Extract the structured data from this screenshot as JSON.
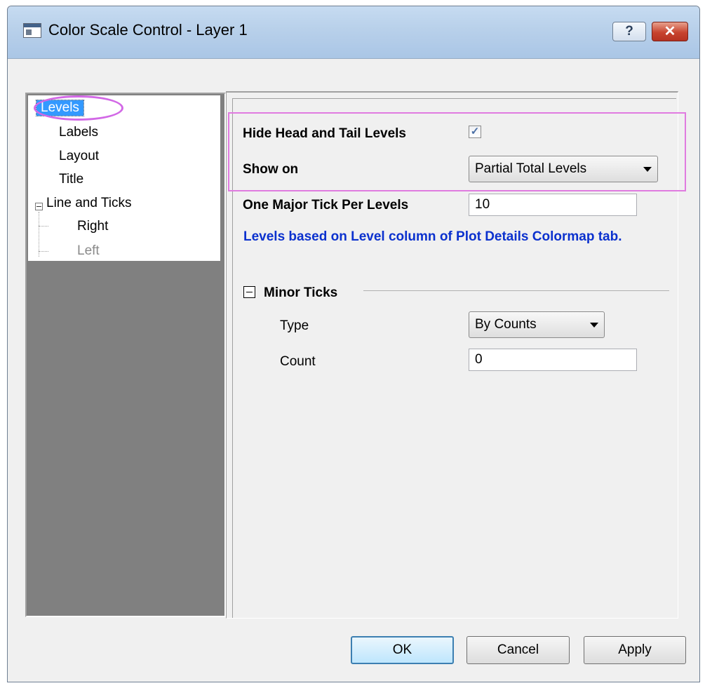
{
  "window": {
    "title": "Color Scale Control - Layer 1",
    "help_label": "?",
    "close_label": "✕"
  },
  "tree": {
    "items": [
      {
        "label": "Levels"
      },
      {
        "label": "Labels"
      },
      {
        "label": "Layout"
      },
      {
        "label": "Title"
      },
      {
        "label": "Line and Ticks"
      },
      {
        "label": "Right"
      },
      {
        "label": "Left"
      }
    ]
  },
  "form": {
    "hide_head_tail_label": "Hide Head and Tail Levels",
    "hide_head_tail_checked": "✓",
    "show_on_label": "Show on",
    "show_on_value": "Partial Total Levels",
    "major_tick_label": "One Major Tick Per Levels",
    "major_tick_value": "10",
    "note": "Levels based on Level column of Plot Details Colormap tab.",
    "minor_ticks_section": "Minor Ticks",
    "type_label": "Type",
    "type_value": "By Counts",
    "count_label": "Count",
    "count_value": "0"
  },
  "buttons": {
    "ok": "OK",
    "cancel": "Cancel",
    "apply": "Apply"
  },
  "colors": {
    "selection": "#3399ff",
    "annotation": "#e07be0",
    "note_text": "#0b31ce"
  }
}
